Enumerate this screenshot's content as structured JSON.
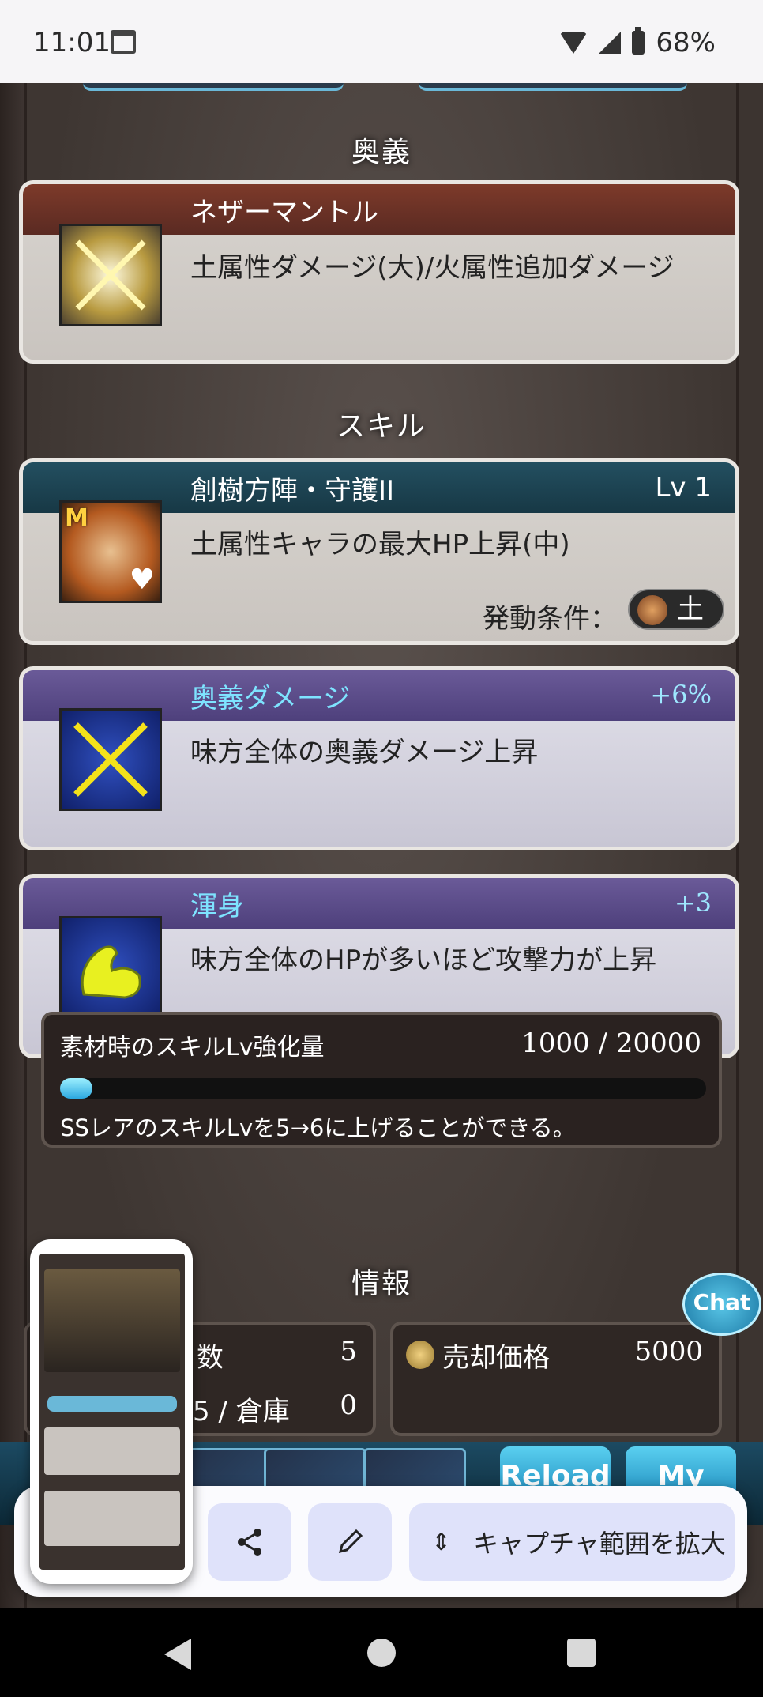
{
  "status_bar": {
    "time": "11:01",
    "battery": "68%"
  },
  "sections": {
    "ougi": "奥義",
    "skill": "スキル",
    "info": "情報"
  },
  "ougi_card": {
    "name": "ネザーマントル",
    "description": "土属性ダメージ(大)/火属性追加ダメージ"
  },
  "skill_cards": [
    {
      "name": "創樹方陣・守護II",
      "level": "Lv 1",
      "description": "土属性キャラの最大HP上昇(中)",
      "condition_label": "発動条件：",
      "condition_value": "土",
      "badge": "M"
    },
    {
      "name": "奥義ダメージ",
      "bonus": "+6%",
      "description": "味方全体の奥義ダメージ上昇"
    },
    {
      "name": "渾身",
      "bonus": "+3",
      "description": "味方全体のHPが多いほど攻撃力が上昇"
    }
  ],
  "skill_exp": {
    "label": "素材時のスキルLv強化量",
    "value": "1000 / 20000",
    "progress": 0.05,
    "note": "SSレアのスキルLvを5→6に上げることができる。"
  },
  "info": {
    "count_label": "数",
    "count_value": "5",
    "storage_label": "5 / 倉庫",
    "storage_value": "0",
    "sell_label": "売却価格",
    "sell_value": "5000"
  },
  "chat_label": "Chat",
  "bottom_buttons": {
    "reload": "Reload",
    "mypage": "My page"
  },
  "capture_bar": {
    "expand_label": "キャプチャ範囲を拡大"
  },
  "colors": {
    "accent_blue": "#2ba8e0",
    "purple_header": "#5a4a88",
    "red_header": "#7a3a2c",
    "teal_header": "#1d4d5e"
  }
}
